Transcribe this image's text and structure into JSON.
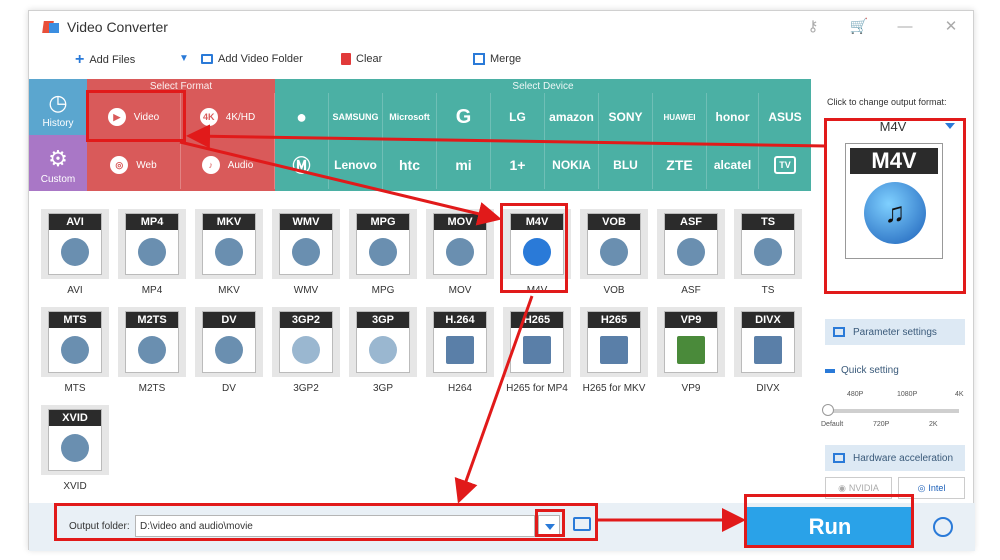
{
  "app": {
    "title": "Video Converter"
  },
  "toolbar": {
    "add_files": "Add Files",
    "add_video_folder": "Add Video Folder",
    "clear": "Clear",
    "merge": "Merge"
  },
  "rail": {
    "history": "History",
    "custom": "Custom"
  },
  "format_bar": {
    "caption": "Select Format",
    "items": [
      "Video",
      "4K/HD",
      "Web",
      "Audio"
    ]
  },
  "device_bar": {
    "caption": "Select Device",
    "row1": [
      "",
      "SAMSUNG",
      "Microsoft",
      "G",
      "LG",
      "amazon",
      "SONY",
      "HUAWEI",
      "honor",
      "ASUS"
    ],
    "row2": [
      "",
      "Lenovo",
      "htc",
      "mi",
      "1+",
      "NOKIA",
      "BLU",
      "ZTE",
      "alcatel",
      "TV"
    ]
  },
  "formats": [
    {
      "head": "AVI",
      "label": "AVI"
    },
    {
      "head": "MP4",
      "label": "MP4"
    },
    {
      "head": "MKV",
      "label": "MKV"
    },
    {
      "head": "WMV",
      "label": "WMV"
    },
    {
      "head": "MPG",
      "label": "MPG"
    },
    {
      "head": "MOV",
      "label": "MOV"
    },
    {
      "head": "M4V",
      "label": "M4V"
    },
    {
      "head": "VOB",
      "label": "VOB"
    },
    {
      "head": "ASF",
      "label": "ASF"
    },
    {
      "head": "TS",
      "label": "TS"
    },
    {
      "head": "MTS",
      "label": "MTS"
    },
    {
      "head": "M2TS",
      "label": "M2TS"
    },
    {
      "head": "DV",
      "label": "DV"
    },
    {
      "head": "3GP2",
      "label": "3GP2"
    },
    {
      "head": "3GP",
      "label": "3GP"
    },
    {
      "head": "H.264",
      "label": "H264"
    },
    {
      "head": "H265",
      "label": "H265 for MP4"
    },
    {
      "head": "H265",
      "label": "H265 for MKV"
    },
    {
      "head": "VP9",
      "label": "VP9"
    },
    {
      "head": "DIVX",
      "label": "DIVX"
    },
    {
      "head": "XVID",
      "label": "XVID"
    }
  ],
  "right_panel": {
    "caption": "Click to change output format:",
    "selected_format": "M4V",
    "big_label": "M4V",
    "parameter_settings": "Parameter settings",
    "quick_setting": "Quick setting",
    "ticks_top": [
      "480P",
      "1080P",
      "4K"
    ],
    "ticks_bottom": [
      "Default",
      "720P",
      "2K"
    ],
    "hardware_acceleration": "Hardware acceleration",
    "nvidia": "NVIDIA",
    "intel": "Intel"
  },
  "bottom": {
    "output_folder_label": "Output folder:",
    "output_folder_value": "D:\\video and audio\\movie",
    "run_label": "Run"
  }
}
